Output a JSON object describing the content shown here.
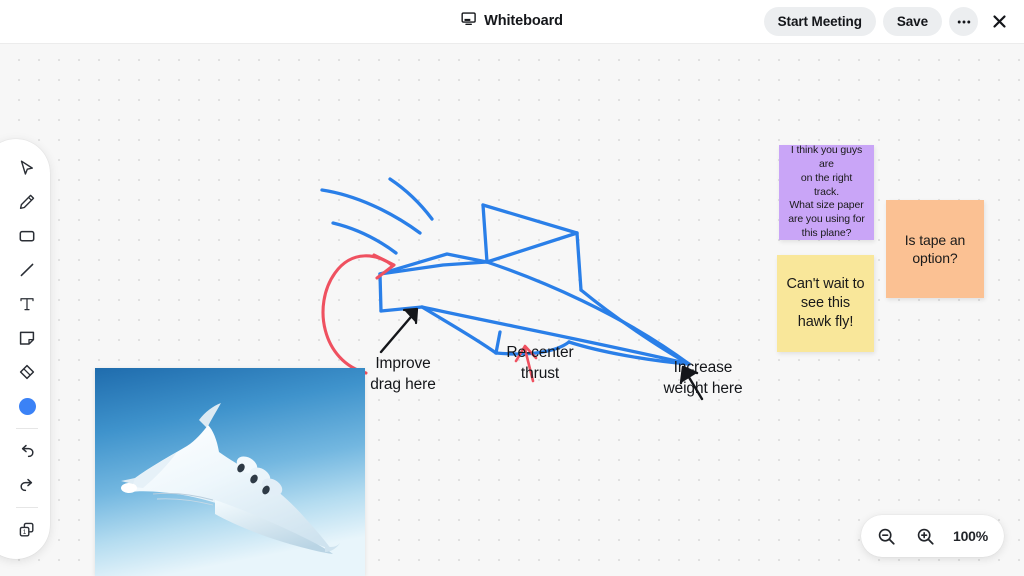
{
  "header": {
    "title": "Whiteboard",
    "title_icon": "whiteboard-screen-icon",
    "start_meeting_label": "Start Meeting",
    "save_label": "Save",
    "more_label": "•••",
    "close_label": "×"
  },
  "toolbar": {
    "items": [
      {
        "name": "select-tool",
        "icon": "cursor-arrow-icon"
      },
      {
        "name": "pen-tool",
        "icon": "pencil-icon"
      },
      {
        "name": "rectangle-tool",
        "icon": "rectangle-icon"
      },
      {
        "name": "line-tool",
        "icon": "line-icon"
      },
      {
        "name": "text-tool",
        "icon": "text-t-icon"
      },
      {
        "name": "sticky-note-tool",
        "icon": "sticky-note-icon"
      },
      {
        "name": "eraser-tool",
        "icon": "eraser-diamond-icon"
      }
    ],
    "color_swatch": {
      "name": "color-swatch-blue",
      "color": "#3b82f6"
    },
    "undo": {
      "name": "undo-button",
      "icon": "undo-arrow-icon"
    },
    "redo": {
      "name": "redo-button",
      "icon": "redo-arrow-icon"
    },
    "frames": {
      "name": "frames-button",
      "icon": "frames-stack-icon",
      "count": "1"
    }
  },
  "canvas": {
    "background_color": "#f7f7f7",
    "dot_color": "#e0e0e0",
    "sketch_color": "#2a7fe8",
    "arrow_red_color": "#ef5160",
    "arrow_black_color": "#14161a",
    "annotations": [
      {
        "name": "annotation-improve-drag",
        "text": "Improve\ndrag here"
      },
      {
        "name": "annotation-recenter-thrust",
        "text": "Re-center\nthrust"
      },
      {
        "name": "annotation-increase-weight",
        "text": "Increase\nweight here"
      }
    ],
    "sticky_notes": [
      {
        "name": "sticky-note-purple",
        "text": "I think you guys are\non the right track.\nWhat size paper\nare you using for\nthis plane?",
        "color": "#c9a5f7",
        "font_size": "10.5px"
      },
      {
        "name": "sticky-note-orange",
        "text": "Is tape an\noption?",
        "color": "#fbc193",
        "font_size": "14px"
      },
      {
        "name": "sticky-note-yellow",
        "text": "Can't wait to\nsee this\nhawk fly!",
        "color": "#f9e79a",
        "font_size": "14.5px"
      }
    ],
    "image_card": {
      "name": "image-card-aircraft",
      "alt": "blended wing body aircraft concept in blue sky"
    }
  },
  "zoom": {
    "zoom_out_label": "zoom-out",
    "zoom_in_label": "zoom-in",
    "level": "100%"
  }
}
